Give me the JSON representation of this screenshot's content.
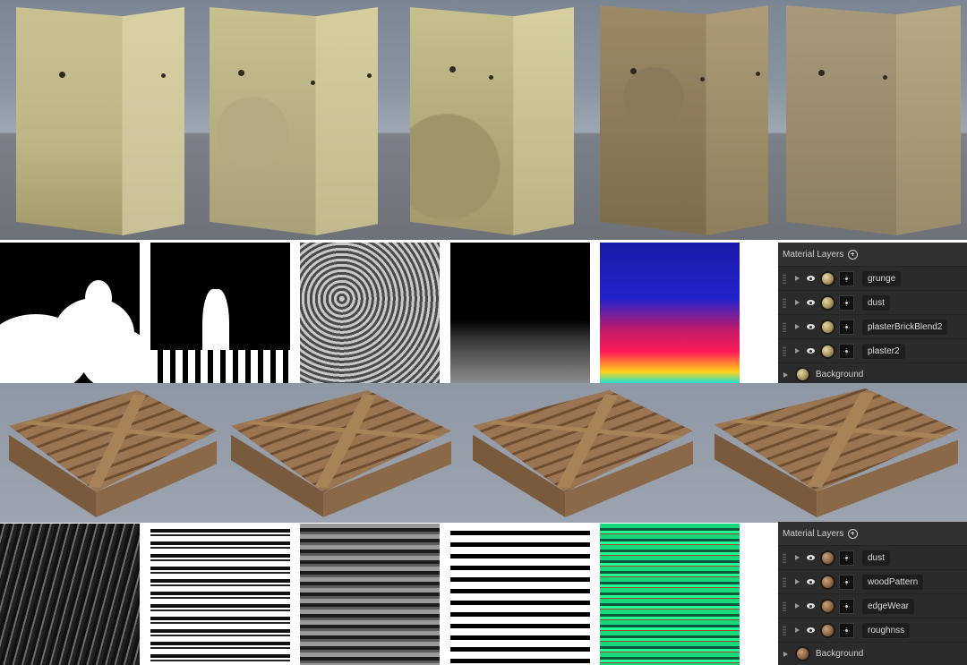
{
  "panels": [
    {
      "title": "Material Layers",
      "layers": [
        "grunge",
        "dust",
        "plasterBrickBlend2",
        "plaster2"
      ],
      "background_label": "Background",
      "material": "plaster"
    },
    {
      "title": "Material Layers",
      "layers": [
        "dust",
        "woodPattern",
        "edgeWear",
        "roughnss"
      ],
      "background_label": "Background",
      "material": "wood"
    }
  ],
  "icons": [
    "add-icon",
    "visibility-eye-icon",
    "expand-arrow-icon",
    "drag-grip-icon",
    "material-ball-icon",
    "mask-thumbnail-icon"
  ],
  "colors": {
    "panel_bg": "#2b2b2b",
    "field_bg": "#1e1e1e",
    "viewport_bg": "#8a93a1"
  }
}
